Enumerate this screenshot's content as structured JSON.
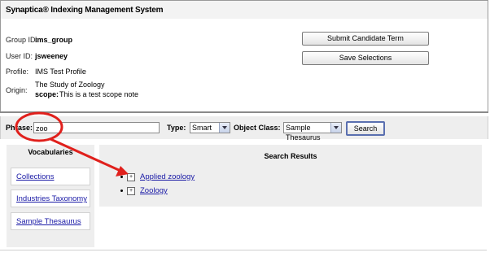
{
  "app": {
    "title": "Synaptica® Indexing Management System"
  },
  "info": {
    "group_label": "Group ID:",
    "group_value": "ims_group",
    "user_label": "User ID:",
    "user_value": "jsweeney",
    "profile_label": "Profile:",
    "profile_value": "IMS Test Profile",
    "origin_label": "Origin:",
    "origin_value": "The Study of Zoology",
    "scope_label": "scope:",
    "scope_value": "This is a test scope note"
  },
  "buttons": {
    "submit_label": "Submit Candidate Term",
    "save_label": "Save Selections",
    "search_label": "Search"
  },
  "search": {
    "phrase_label": "Phrase:",
    "phrase_value": "zoo",
    "type_label": "Type:",
    "type_value": "Smart",
    "class_label": "Object Class:",
    "class_value": "Sample Thesaurus"
  },
  "vocabularies": {
    "heading": "Vocabularies",
    "items": [
      {
        "label": "Collections"
      },
      {
        "label": "Industries Taxonomy"
      },
      {
        "label": "Sample Thesaurus"
      }
    ]
  },
  "results": {
    "heading": "Search Results",
    "items": [
      {
        "expander": "+",
        "label": "Applied zoology"
      },
      {
        "expander": "+",
        "label": "Zoology"
      }
    ]
  },
  "annotation": {
    "color": "#e0201c"
  }
}
